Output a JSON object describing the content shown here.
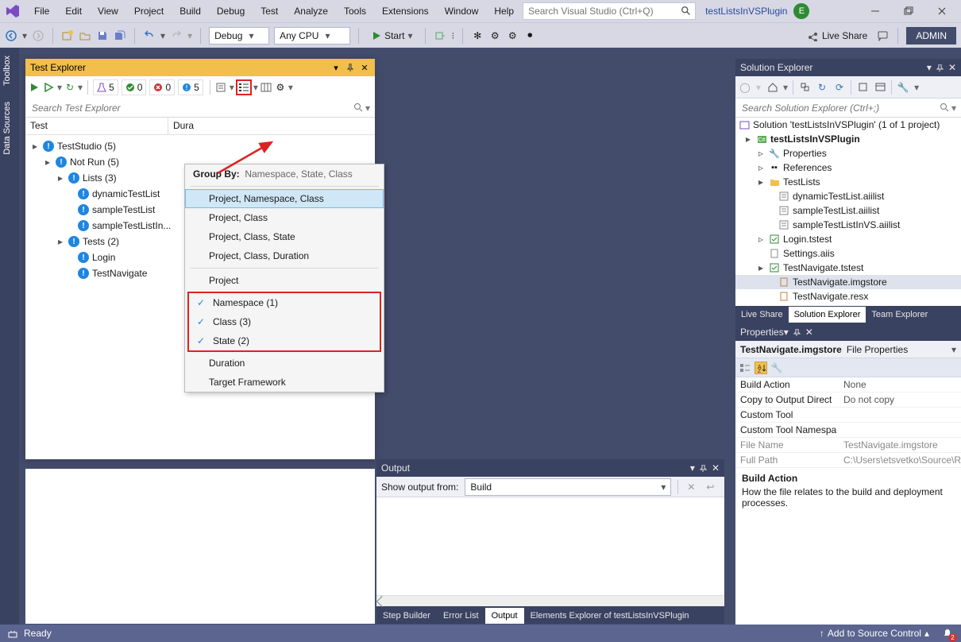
{
  "menu": {
    "file": "File",
    "edit": "Edit",
    "view": "View",
    "project": "Project",
    "build": "Build",
    "debug": "Debug",
    "test": "Test",
    "analyze": "Analyze",
    "tools": "Tools",
    "extensions": "Extensions",
    "window": "Window",
    "help": "Help"
  },
  "search_vs_placeholder": "Search Visual Studio (Ctrl+Q)",
  "account_name": "testListsInVSPlugin",
  "account_initial": "E",
  "toolbar": {
    "config": "Debug",
    "platform": "Any CPU",
    "start": "Start",
    "liveshare": "Live Share",
    "admin": "ADMIN"
  },
  "left_tabs": {
    "toolbox": "Toolbox",
    "datasources": "Data Sources"
  },
  "test_explorer": {
    "title": "Test Explorer",
    "search_placeholder": "Search Test Explorer",
    "counts": {
      "flask": "5",
      "pass": "0",
      "fail": "0",
      "info": "5"
    },
    "col_test": "Test",
    "col_dur": "Dura",
    "root": "TestStudio  (5)",
    "notrun": "Not Run  (5)",
    "lists": "Lists  (3)",
    "list_items": [
      "dynamicTestList",
      "sampleTestList",
      "sampleTestListIn..."
    ],
    "tests": "Tests  (2)",
    "test_items": [
      "Login",
      "TestNavigate"
    ]
  },
  "group_by": {
    "label": "Group By:",
    "current": "Namespace, State, Class",
    "opts": [
      "Project, Namespace, Class",
      "Project, Class",
      "Project, Class, State",
      "Project, Class, Duration",
      "Project",
      "Namespace (1)",
      "Class (3)",
      "State (2)",
      "Duration",
      "Target Framework"
    ]
  },
  "output": {
    "title": "Output",
    "show_label": "Show output from:",
    "source": "Build",
    "tabs": [
      "Step Builder",
      "Error List",
      "Output",
      "Elements Explorer of testListsInVSPlugin"
    ]
  },
  "solution": {
    "title": "Solution Explorer",
    "search_placeholder": "Search Solution Explorer (Ctrl+;)",
    "root": "Solution 'testListsInVSPlugin' (1 of 1 project)",
    "project": "testListsInVSPlugin",
    "nodes": {
      "properties": "Properties",
      "references": "References",
      "folder": "TestLists",
      "tl_items": [
        "dynamicTestList.aiilist",
        "sampleTestList.aiilist",
        "sampleTestListInVS.aiilist"
      ],
      "login": "Login.tstest",
      "settings": "Settings.aiis",
      "nav": "TestNavigate.tstest",
      "nav_children": [
        "TestNavigate.imgstore",
        "TestNavigate.resx"
      ]
    },
    "tabs": [
      "Live Share",
      "Solution Explorer",
      "Team Explorer"
    ]
  },
  "properties": {
    "title": "Properties",
    "object": "TestNavigate.imgstore",
    "type": "File Properties",
    "rows": [
      {
        "l": "Build Action",
        "v": "None"
      },
      {
        "l": "Copy to Output Direct",
        "v": "Do not copy"
      },
      {
        "l": "Custom Tool",
        "v": ""
      },
      {
        "l": "Custom Tool Namespa",
        "v": ""
      },
      {
        "l": "File Name",
        "v": "TestNavigate.imgstore",
        "ro": true
      },
      {
        "l": "Full Path",
        "v": "C:\\Users\\etsvetko\\Source\\R",
        "ro": true
      }
    ],
    "desc_title": "Build Action",
    "desc_body": "How the file relates to the build and deployment processes."
  },
  "status": {
    "ready": "Ready",
    "src": "Add to Source Control",
    "notif": "2"
  }
}
